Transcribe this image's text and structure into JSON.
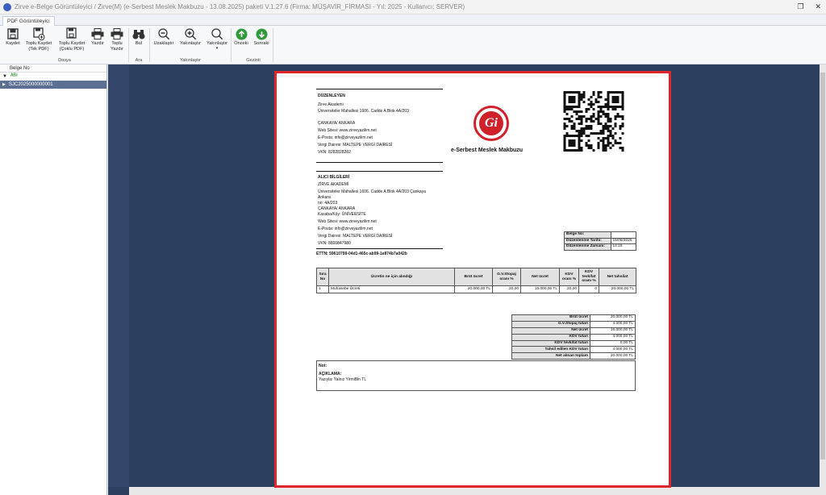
{
  "window": {
    "title": "Zirve e-Belge Görüntüleyici / Zirve(M)  (e-Serbest Meslek Makbuzu - 13.08.2025) paketi V.1.27.6 (Firma: MÜŞAVİR_FİRMASI - Yıl: 2025 - Kullanıcı: SERVER)",
    "restore_glyph": "❐",
    "close_glyph": "✕"
  },
  "tab": {
    "label": "PDF Görüntüleyici"
  },
  "ribbon": {
    "buttons": [
      {
        "label": "Kaydet",
        "icon": "save-icon"
      },
      {
        "label": "Toplu Kaydet\n(Tek PDF)",
        "icon": "save-multi-icon"
      },
      {
        "label": "Toplu Kaydet\n(Çoklu PDF)",
        "icon": "save-multi-icon"
      },
      {
        "label": "Yazdır",
        "icon": "print-icon"
      },
      {
        "label": "Toplu\nYazdır",
        "icon": "print-icon"
      },
      {
        "label": "Bul",
        "icon": "binoculars-icon"
      },
      {
        "label": "Uzaklaştır",
        "icon": "zoom-out-icon"
      },
      {
        "label": "Yakınlaştır",
        "icon": "zoom-in-icon"
      },
      {
        "label": "Yakınlaştır",
        "icon": "zoom-icon"
      },
      {
        "label": "Önceki",
        "icon": "arrow-up-icon"
      },
      {
        "label": "Sonraki",
        "icon": "arrow-down-icon"
      }
    ],
    "groups": [
      "Dosya",
      "Ara",
      "Yakınlaştır",
      "Gezinti"
    ]
  },
  "left_pane": {
    "header": "Belge No",
    "rows": [
      "",
      "SJC2025000000001"
    ]
  },
  "document": {
    "issuer_heading": "DÜZENLEYEN",
    "issuer_lines": [
      "Zirve Akademi",
      "Üniversiteler Mahallesi 1606. Cadde A Blok 4A/203",
      "",
      "ÇANKAYA/ ANKARA",
      "Web Sitesi: www.zirveyazilim.net",
      "E-Posta: info@zirveyazilim.net",
      "Vergi Dairesi: MALTEPE VERGİ DAİRESİ",
      "VKN: 8282828282"
    ],
    "doc_title": "e-Serbest Meslek Makbuzu",
    "receiver_heading": "ALICI BİLGİLERİ",
    "receiver_lines": [
      "ZİRVE AKADEMİ",
      "Üniversiteler Mahallesi 1606. Cadde A Blok 4A/203 Çankaya",
      "Ankara",
      "  no: 4A/203",
      "ÇANKAYA/ ANKARA",
      "Kasaba/Köy: ÜNİVERSİTE",
      "Web Sitesi: www.zirveyazilim.net",
      "E-Posta: info@zirveyazilim.net",
      "Vergi Dairesi: MALTEPE VERGİ DAİRESİ",
      "VKN: 8800847980"
    ],
    "ettn": "ETTN: 59610799-04d1-465c-ab99-1e874b7a042b",
    "meta": [
      {
        "k": "Belge No:",
        "v": ""
      },
      {
        "k": "Düzenlenme Tarihi:",
        "v": "15/08/2025"
      },
      {
        "k": "Düzenlenme Zamanı:",
        "v": "14:18"
      }
    ],
    "items_headers": [
      "Sıra No",
      "Ücretin ne için alındığı",
      "Brüt ücret",
      "G.V.Stopaj oranı %",
      "Net ücret",
      "KDV oranı %",
      "KDV tevkifat oranı %",
      "Net tahsilat"
    ],
    "items": [
      [
        "1",
        "Muhasebe Ücreti",
        "20.000,00 TL",
        "20,00",
        "16.000,00 TL",
        "20,00",
        "0",
        "20.000,00 TL"
      ]
    ],
    "totals": [
      {
        "k": "Brüt ücret",
        "v": "20.000,00 TL"
      },
      {
        "k": "G.V.Stopaj tutarı",
        "v": "4.000,00 TL"
      },
      {
        "k": "Net ücret",
        "v": "16.000,00 TL"
      },
      {
        "k": "KDV tutarı",
        "v": "4.000,00 TL"
      },
      {
        "k": "KDV tevkifat tutarı",
        "v": "0,00 TL"
      },
      {
        "k": "Tahsil edilen KDV tutarı",
        "v": "4.000,00 TL"
      },
      {
        "k": "Net alınan toplam",
        "v": "20.000,00 TL"
      }
    ],
    "note_label": "Not:",
    "note_heading": "AÇIKLAMA:",
    "note_text": "Yazıyla: Yalnız YirmiBin TL"
  }
}
